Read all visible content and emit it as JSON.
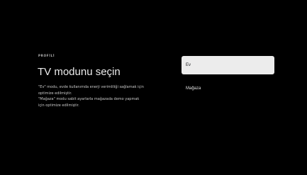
{
  "section_label": "PROFİLİ",
  "title": "TV modunu seçin",
  "description": {
    "lines": [
      "\"Ev\" modu, evde kullanımda enerji verimliliği sağlamak için",
      "optimize edilmiştir.",
      "\"Mağaza\" modu sabit ayarlarla mağazada demo yapmak",
      "için optimize edilmiştir."
    ]
  },
  "options": [
    {
      "label": "Ev",
      "focused": true
    },
    {
      "label": "Mağaza",
      "focused": false
    }
  ],
  "colors": {
    "background": "#000000",
    "focused_option_bg": "#ececec",
    "title_text": "#ececec",
    "body_text": "#c9c9c9"
  }
}
